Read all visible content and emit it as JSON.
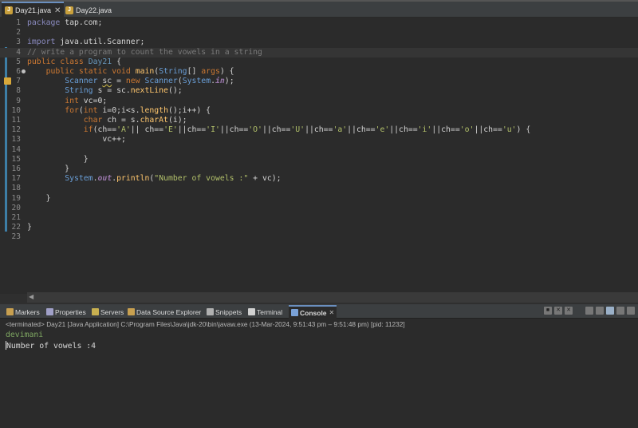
{
  "editor_tabs": [
    {
      "label": "Day21.java",
      "active": true,
      "closable": true
    },
    {
      "label": "Day22.java",
      "active": false,
      "closable": false
    }
  ],
  "code_lines": [
    {
      "n": "1",
      "tokens": [
        {
          "t": "package",
          "c": "kw2"
        },
        {
          "t": " tap.com;",
          "c": "txt"
        }
      ]
    },
    {
      "n": "2",
      "tokens": []
    },
    {
      "n": "3",
      "tokens": [
        {
          "t": "import",
          "c": "kw2"
        },
        {
          "t": " java.util.Scanner;",
          "c": "txt"
        }
      ]
    },
    {
      "n": "4",
      "tokens": [
        {
          "t": "// write a program to count the vowels in a string",
          "c": "cm"
        }
      ],
      "hl": true
    },
    {
      "n": "5",
      "tokens": [
        {
          "t": "public",
          "c": "kw"
        },
        {
          "t": " ",
          "c": "txt"
        },
        {
          "t": "class",
          "c": "kw"
        },
        {
          "t": " ",
          "c": "txt"
        },
        {
          "t": "Day21",
          "c": "cls"
        },
        {
          "t": " {",
          "c": "txt"
        }
      ]
    },
    {
      "n": "6",
      "tokens": [
        {
          "t": "    ",
          "c": "txt"
        },
        {
          "t": "public",
          "c": "kw"
        },
        {
          "t": " ",
          "c": "txt"
        },
        {
          "t": "static",
          "c": "kw"
        },
        {
          "t": " ",
          "c": "txt"
        },
        {
          "t": "void",
          "c": "kw"
        },
        {
          "t": " ",
          "c": "txt"
        },
        {
          "t": "main",
          "c": "mth"
        },
        {
          "t": "(",
          "c": "txt"
        },
        {
          "t": "String",
          "c": "typ"
        },
        {
          "t": "[] ",
          "c": "txt"
        },
        {
          "t": "args",
          "c": "kw"
        },
        {
          "t": ") {",
          "c": "txt"
        }
      ]
    },
    {
      "n": "7",
      "tokens": [
        {
          "t": "        ",
          "c": "txt"
        },
        {
          "t": "Scanner",
          "c": "typ"
        },
        {
          "t": " ",
          "c": "txt"
        },
        {
          "t": "sc",
          "c": "warn"
        },
        {
          "t": " = ",
          "c": "txt"
        },
        {
          "t": "new",
          "c": "kw"
        },
        {
          "t": " ",
          "c": "txt"
        },
        {
          "t": "Scanner",
          "c": "typ"
        },
        {
          "t": "(",
          "c": "txt"
        },
        {
          "t": "System",
          "c": "typ"
        },
        {
          "t": ".",
          "c": "txt"
        },
        {
          "t": "in",
          "c": "fld"
        },
        {
          "t": ");",
          "c": "txt"
        }
      ]
    },
    {
      "n": "8",
      "tokens": [
        {
          "t": "        ",
          "c": "txt"
        },
        {
          "t": "String",
          "c": "typ"
        },
        {
          "t": " s = sc.",
          "c": "txt"
        },
        {
          "t": "nextLine",
          "c": "mth"
        },
        {
          "t": "();",
          "c": "txt"
        }
      ]
    },
    {
      "n": "9",
      "tokens": [
        {
          "t": "        ",
          "c": "txt"
        },
        {
          "t": "int",
          "c": "kw"
        },
        {
          "t": " vc=0;",
          "c": "txt"
        }
      ]
    },
    {
      "n": "10",
      "tokens": [
        {
          "t": "        ",
          "c": "txt"
        },
        {
          "t": "for",
          "c": "kw"
        },
        {
          "t": "(",
          "c": "txt"
        },
        {
          "t": "int",
          "c": "kw"
        },
        {
          "t": " i=0;i<s.",
          "c": "txt"
        },
        {
          "t": "length",
          "c": "mth"
        },
        {
          "t": "();i++) {",
          "c": "txt"
        }
      ]
    },
    {
      "n": "11",
      "tokens": [
        {
          "t": "            ",
          "c": "txt"
        },
        {
          "t": "char",
          "c": "kw"
        },
        {
          "t": " ch = s.",
          "c": "txt"
        },
        {
          "t": "charAt",
          "c": "mth"
        },
        {
          "t": "(i);",
          "c": "txt"
        }
      ]
    },
    {
      "n": "12",
      "tokens": [
        {
          "t": "            ",
          "c": "txt"
        },
        {
          "t": "if",
          "c": "kw"
        },
        {
          "t": "(ch==",
          "c": "txt"
        },
        {
          "t": "'A'",
          "c": "str"
        },
        {
          "t": "|| ch==",
          "c": "txt"
        },
        {
          "t": "'E'",
          "c": "str"
        },
        {
          "t": "||ch==",
          "c": "txt"
        },
        {
          "t": "'I'",
          "c": "str"
        },
        {
          "t": "||ch==",
          "c": "txt"
        },
        {
          "t": "'O'",
          "c": "str"
        },
        {
          "t": "||ch==",
          "c": "txt"
        },
        {
          "t": "'U'",
          "c": "str"
        },
        {
          "t": "||ch==",
          "c": "txt"
        },
        {
          "t": "'a'",
          "c": "str"
        },
        {
          "t": "||ch==",
          "c": "txt"
        },
        {
          "t": "'e'",
          "c": "str"
        },
        {
          "t": "||ch==",
          "c": "txt"
        },
        {
          "t": "'i'",
          "c": "str"
        },
        {
          "t": "||ch==",
          "c": "txt"
        },
        {
          "t": "'o'",
          "c": "str"
        },
        {
          "t": "||ch==",
          "c": "txt"
        },
        {
          "t": "'u'",
          "c": "str"
        },
        {
          "t": ") {",
          "c": "txt"
        }
      ]
    },
    {
      "n": "13",
      "tokens": [
        {
          "t": "                vc++;",
          "c": "txt"
        }
      ]
    },
    {
      "n": "14",
      "tokens": []
    },
    {
      "n": "15",
      "tokens": [
        {
          "t": "            }",
          "c": "txt"
        }
      ]
    },
    {
      "n": "16",
      "tokens": [
        {
          "t": "        }",
          "c": "txt"
        }
      ]
    },
    {
      "n": "17",
      "tokens": [
        {
          "t": "        ",
          "c": "txt"
        },
        {
          "t": "System",
          "c": "typ"
        },
        {
          "t": ".",
          "c": "txt"
        },
        {
          "t": "out",
          "c": "fld"
        },
        {
          "t": ".",
          "c": "txt"
        },
        {
          "t": "println",
          "c": "mth"
        },
        {
          "t": "(",
          "c": "txt"
        },
        {
          "t": "\"Number of vowels :\"",
          "c": "str"
        },
        {
          "t": " + vc);",
          "c": "txt"
        }
      ]
    },
    {
      "n": "18",
      "tokens": []
    },
    {
      "n": "19",
      "tokens": [
        {
          "t": "    }",
          "c": "txt"
        }
      ]
    },
    {
      "n": "20",
      "tokens": []
    },
    {
      "n": "21",
      "tokens": []
    },
    {
      "n": "22",
      "tokens": [
        {
          "t": "}",
          "c": "txt"
        }
      ]
    },
    {
      "n": "23",
      "tokens": []
    }
  ],
  "view_tabs": [
    {
      "label": "Markers",
      "icon": "markers-icon",
      "color": "#c8a050"
    },
    {
      "label": "Properties",
      "icon": "properties-icon",
      "color": "#a0a0c8"
    },
    {
      "label": "Servers",
      "icon": "servers-icon",
      "color": "#c8b050"
    },
    {
      "label": "Data Source Explorer",
      "icon": "data-source-icon",
      "color": "#c8a050"
    },
    {
      "label": "Snippets",
      "icon": "snippets-icon",
      "color": "#b0b0b0"
    },
    {
      "label": "Terminal",
      "icon": "terminal-icon",
      "color": "#d0d0d0"
    },
    {
      "label": "Console",
      "icon": "console-icon",
      "color": "#7aa2d8",
      "active": true
    }
  ],
  "console": {
    "status": "<terminated> Day21 [Java Application] C:\\Program Files\\Java\\jdk-20\\bin\\javaw.exe  (13-Mar-2024, 9:51:43 pm – 9:51:48 pm) [pid: 11232]",
    "input_line": "devimani",
    "output_line": "Number of vowels :4"
  }
}
